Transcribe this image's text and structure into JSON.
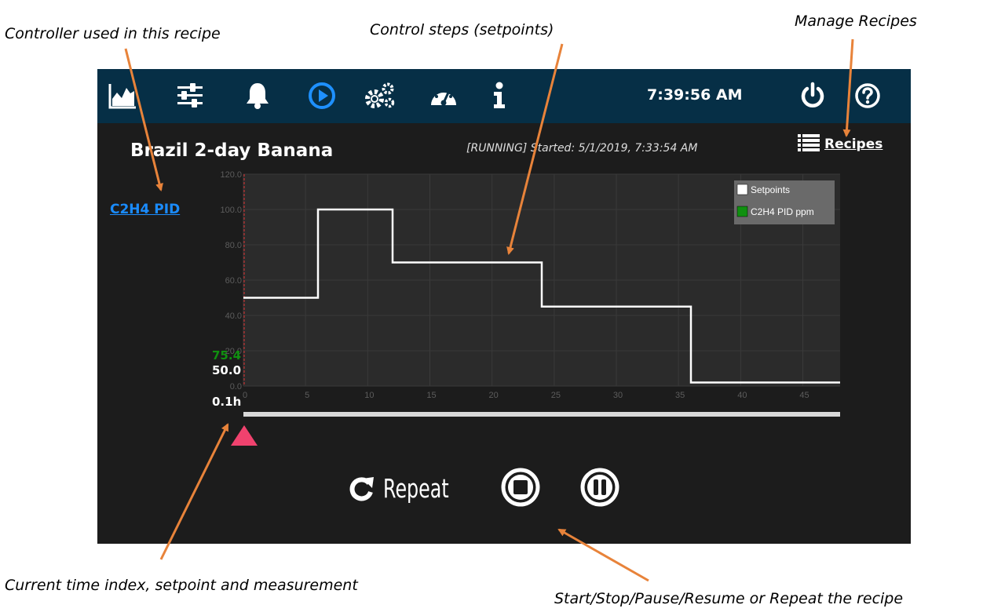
{
  "callouts": {
    "controller": "Controller used in this recipe",
    "steps": "Control steps (setpoints)",
    "manage": "Manage Recipes",
    "time_index": "Current time index, setpoint and measurement",
    "start_stop": "Start/Stop/Pause/Resume or Repeat the recipe"
  },
  "colors": {
    "nav_bg": "#062f46",
    "panel_bg": "#1c1c1c",
    "plot_bg": "#2b2b2b",
    "active_icon": "#1e90ff",
    "link": "#1a8cff",
    "measurement": "#109010",
    "marker": "#f0426e",
    "arrow": "#e8833a"
  },
  "nav": {
    "icons": [
      "area-chart-icon",
      "sliders-icon",
      "bell-icon",
      "play-circle-icon",
      "gears-icon",
      "gauge-icon",
      "info-icon"
    ],
    "active": "play-circle-icon",
    "clock": "7:39:56 AM",
    "right_icons": [
      "power-icon",
      "help-icon"
    ]
  },
  "recipe": {
    "title": "Brazil 2-day Banana",
    "status": "[RUNNING] Started: 5/1/2019, 7:33:54 AM",
    "recipes_link": "Recipes",
    "controller": "C2H4 PID"
  },
  "readouts": {
    "measurement": "75.4",
    "setpoint": "50.0",
    "time": "0.1h"
  },
  "controls": {
    "repeat": "Repeat",
    "stop": "stop-icon",
    "pause": "pause-icon"
  },
  "chart_data": {
    "type": "line",
    "step": true,
    "xlim": [
      0,
      48
    ],
    "ylim": [
      0,
      120
    ],
    "x_ticks": [
      0,
      5,
      10,
      15,
      20,
      25,
      30,
      35,
      40,
      45
    ],
    "y_ticks": [
      "0.0",
      "20.0",
      "40.0",
      "60.0",
      "80.0",
      "100.0",
      "120.0"
    ],
    "grid": true,
    "legend_position": "top-right",
    "current_time_index": 0.1,
    "series": [
      {
        "name": "Setpoints",
        "color": "#ffffff",
        "points": [
          [
            0,
            50
          ],
          [
            6,
            50
          ],
          [
            6,
            100
          ],
          [
            12,
            100
          ],
          [
            12,
            70
          ],
          [
            24,
            70
          ],
          [
            24,
            45
          ],
          [
            36,
            45
          ],
          [
            36,
            2
          ],
          [
            48,
            2
          ]
        ]
      },
      {
        "name": "C2H4 PID ppm",
        "color": "#109010",
        "points": []
      }
    ]
  }
}
